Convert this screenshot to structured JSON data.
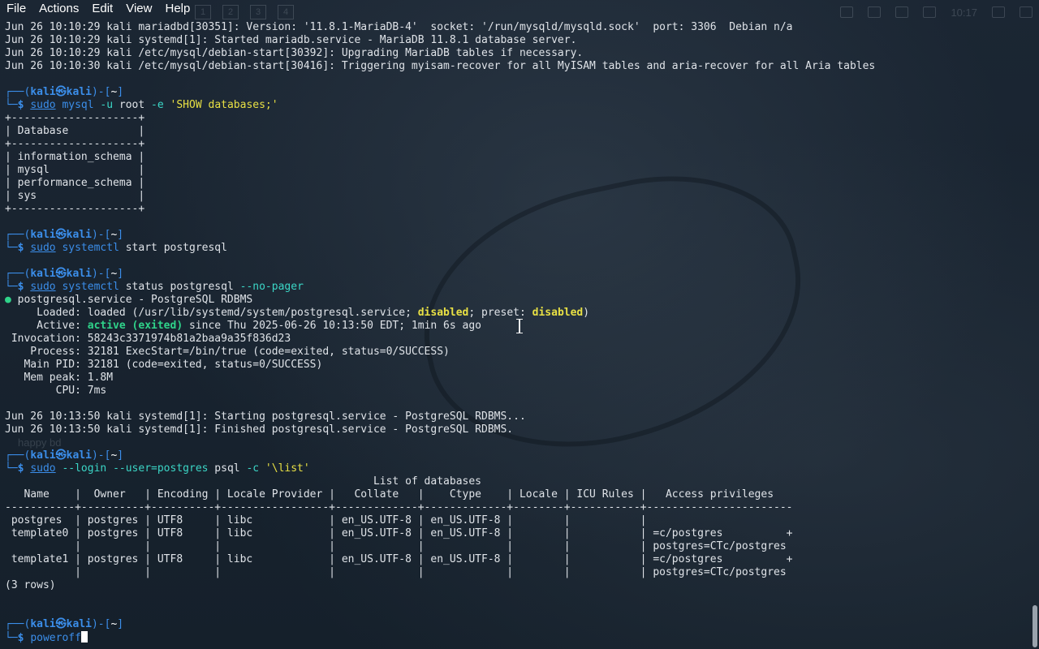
{
  "menubar": {
    "items": [
      "File",
      "Actions",
      "Edit",
      "View",
      "Help"
    ]
  },
  "panel_ghost": {
    "workspaces": [
      "1",
      "2",
      "3",
      "4"
    ],
    "clock": "10:17"
  },
  "ghost_label": "happy bd",
  "terminal": {
    "prompt_user": "kali",
    "prompt_host": "kali",
    "prompt_dir": "~",
    "lines": [
      {
        "type": "plain",
        "text": "Jun 26 10:10:29 kali mariadbd[30351]: Version: '11.8.1-MariaDB-4'  socket: '/run/mysqld/mysqld.sock'  port: 3306  Debian n/a"
      },
      {
        "type": "plain",
        "text": "Jun 26 10:10:29 kali systemd[1]: Started mariadb.service - MariaDB 11.8.1 database server."
      },
      {
        "type": "plain",
        "text": "Jun 26 10:10:29 kali /etc/mysql/debian-start[30392]: Upgrading MariaDB tables if necessary."
      },
      {
        "type": "plain",
        "text": "Jun 26 10:10:30 kali /etc/mysql/debian-start[30416]: Triggering myisam-recover for all MyISAM tables and aria-recover for all Aria tables"
      },
      {
        "type": "blank"
      },
      {
        "type": "prompt1"
      },
      {
        "type": "cmd",
        "parts": [
          [
            "sudo",
            "sudo"
          ],
          [
            " ",
            ""
          ],
          [
            "mysql",
            "cmd"
          ],
          [
            " ",
            ""
          ],
          [
            "-u",
            "opt"
          ],
          [
            " root ",
            ""
          ],
          [
            "-e",
            "opt"
          ],
          [
            " ",
            ""
          ],
          [
            "'SHOW databases;'",
            "str"
          ]
        ]
      },
      {
        "type": "plain",
        "text": "+--------------------+"
      },
      {
        "type": "plain",
        "text": "| Database           |"
      },
      {
        "type": "plain",
        "text": "+--------------------+"
      },
      {
        "type": "plain",
        "text": "| information_schema |"
      },
      {
        "type": "plain",
        "text": "| mysql              |"
      },
      {
        "type": "plain",
        "text": "| performance_schema |"
      },
      {
        "type": "plain",
        "text": "| sys                |"
      },
      {
        "type": "plain",
        "text": "+--------------------+"
      },
      {
        "type": "blank"
      },
      {
        "type": "prompt1"
      },
      {
        "type": "cmd",
        "parts": [
          [
            "sudo",
            "sudo"
          ],
          [
            " ",
            ""
          ],
          [
            "systemctl",
            "cmd"
          ],
          [
            " start postgresql",
            ""
          ]
        ]
      },
      {
        "type": "blank"
      },
      {
        "type": "prompt1"
      },
      {
        "type": "cmd",
        "parts": [
          [
            "sudo",
            "sudo"
          ],
          [
            " ",
            ""
          ],
          [
            "systemctl",
            "cmd"
          ],
          [
            " status postgresql ",
            ""
          ],
          [
            "--no-pager",
            "opt"
          ]
        ]
      },
      {
        "type": "rich",
        "parts": [
          [
            "● ",
            "dot"
          ],
          [
            "postgresql.service - PostgreSQL RDBMS",
            ""
          ]
        ]
      },
      {
        "type": "rich",
        "parts": [
          [
            "     Loaded: loaded (/usr/lib/systemd/system/postgresql.service; ",
            ""
          ],
          [
            "disabled",
            "yellow"
          ],
          [
            "; preset: ",
            ""
          ],
          [
            "disabled",
            "yellow"
          ],
          [
            ")",
            ""
          ]
        ]
      },
      {
        "type": "rich",
        "parts": [
          [
            "     Active: ",
            ""
          ],
          [
            "active (exited)",
            "green"
          ],
          [
            " since Thu 2025-06-26 10:13:50 EDT; 1min 6s ago",
            ""
          ]
        ]
      },
      {
        "type": "plain",
        "text": " Invocation: 58243c3371974b81a2baa9a35f836d23"
      },
      {
        "type": "plain",
        "text": "    Process: 32181 ExecStart=/bin/true (code=exited, status=0/SUCCESS)"
      },
      {
        "type": "plain",
        "text": "   Main PID: 32181 (code=exited, status=0/SUCCESS)"
      },
      {
        "type": "plain",
        "text": "   Mem peak: 1.8M"
      },
      {
        "type": "plain",
        "text": "        CPU: 7ms"
      },
      {
        "type": "blank"
      },
      {
        "type": "plain",
        "text": "Jun 26 10:13:50 kali systemd[1]: Starting postgresql.service - PostgreSQL RDBMS..."
      },
      {
        "type": "plain",
        "text": "Jun 26 10:13:50 kali systemd[1]: Finished postgresql.service - PostgreSQL RDBMS."
      },
      {
        "type": "blank"
      },
      {
        "type": "prompt1"
      },
      {
        "type": "cmd",
        "parts": [
          [
            "sudo",
            "sudo"
          ],
          [
            " ",
            ""
          ],
          [
            "--login --user=postgres",
            "opt"
          ],
          [
            " psql ",
            ""
          ],
          [
            "-c",
            "opt"
          ],
          [
            " ",
            ""
          ],
          [
            "'\\list'",
            "str"
          ]
        ]
      },
      {
        "type": "plain",
        "text": "                                                          List of databases"
      },
      {
        "type": "plain",
        "text": "   Name    |  Owner   | Encoding | Locale Provider |   Collate   |    Ctype    | Locale | ICU Rules |   Access privileges"
      },
      {
        "type": "plain",
        "text": "-----------+----------+----------+-----------------+-------------+-------------+--------+-----------+-----------------------"
      },
      {
        "type": "plain",
        "text": " postgres  | postgres | UTF8     | libc            | en_US.UTF-8 | en_US.UTF-8 |        |           |"
      },
      {
        "type": "plain",
        "text": " template0 | postgres | UTF8     | libc            | en_US.UTF-8 | en_US.UTF-8 |        |           | =c/postgres          +"
      },
      {
        "type": "plain",
        "text": "           |          |          |                 |             |             |        |           | postgres=CTc/postgres"
      },
      {
        "type": "plain",
        "text": " template1 | postgres | UTF8     | libc            | en_US.UTF-8 | en_US.UTF-8 |        |           | =c/postgres          +"
      },
      {
        "type": "plain",
        "text": "           |          |          |                 |             |             |        |           | postgres=CTc/postgres"
      },
      {
        "type": "plain",
        "text": "(3 rows)"
      },
      {
        "type": "blank"
      },
      {
        "type": "blank"
      },
      {
        "type": "prompt1"
      },
      {
        "type": "cmd_cursor",
        "parts": [
          [
            "poweroff",
            "cmd"
          ]
        ]
      }
    ]
  }
}
